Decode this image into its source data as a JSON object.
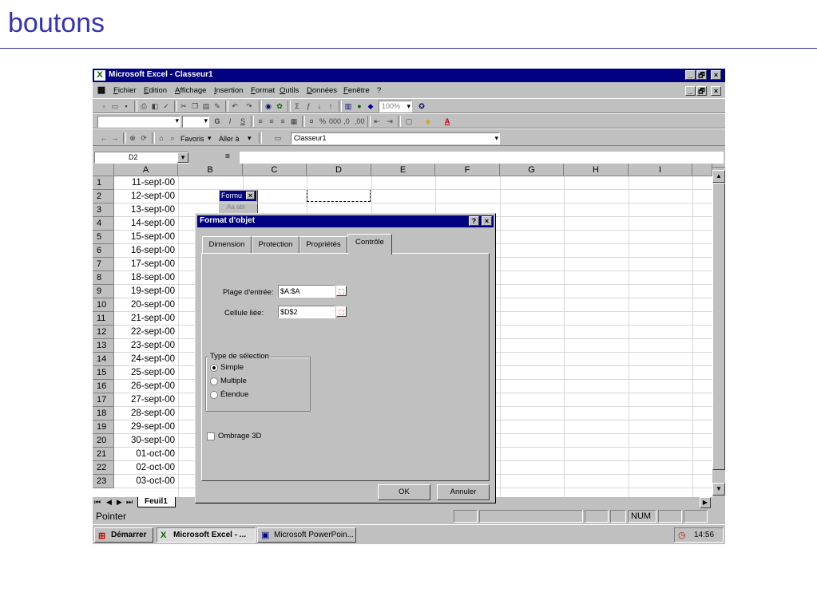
{
  "slide": {
    "title": "boutons"
  },
  "window": {
    "title": "Microsoft Excel - Classeur1",
    "minimize": "_",
    "restore": "🗗",
    "close": "×"
  },
  "menu": [
    "Fichier",
    "Edition",
    "Affichage",
    "Insertion",
    "Format",
    "Outils",
    "Données",
    "Fenêtre",
    "?"
  ],
  "toolbar": {
    "zoom": "100%",
    "favoris": "Favoris",
    "aller": "Aller à",
    "address": "Classeur1"
  },
  "formula_bar": {
    "name_box": "D2",
    "equals": "="
  },
  "columns": [
    "A",
    "B",
    "C",
    "D",
    "E",
    "F",
    "G",
    "H",
    "I"
  ],
  "rows": [
    {
      "n": "1",
      "a": "11-sept-00"
    },
    {
      "n": "2",
      "a": "12-sept-00"
    },
    {
      "n": "3",
      "a": "13-sept-00"
    },
    {
      "n": "4",
      "a": "14-sept-00"
    },
    {
      "n": "5",
      "a": "15-sept-00"
    },
    {
      "n": "6",
      "a": "16-sept-00"
    },
    {
      "n": "7",
      "a": "17-sept-00"
    },
    {
      "n": "8",
      "a": "18-sept-00"
    },
    {
      "n": "9",
      "a": "19-sept-00"
    },
    {
      "n": "10",
      "a": "20-sept-00"
    },
    {
      "n": "11",
      "a": "21-sept-00"
    },
    {
      "n": "12",
      "a": "22-sept-00"
    },
    {
      "n": "13",
      "a": "23-sept-00"
    },
    {
      "n": "14",
      "a": "24-sept-00"
    },
    {
      "n": "15",
      "a": "25-sept-00"
    },
    {
      "n": "16",
      "a": "26-sept-00"
    },
    {
      "n": "17",
      "a": "27-sept-00"
    },
    {
      "n": "18",
      "a": "28-sept-00"
    },
    {
      "n": "19",
      "a": "29-sept-00"
    },
    {
      "n": "20",
      "a": "30-sept-00"
    },
    {
      "n": "21",
      "a": "01-oct-00"
    },
    {
      "n": "22",
      "a": "02-oct-00"
    },
    {
      "n": "23",
      "a": "03-oct-00"
    }
  ],
  "forms_palette": {
    "title": "Formu",
    "close": "×",
    "item": "Aa abl"
  },
  "dialog": {
    "title": "Format d'objet",
    "help": "?",
    "close": "×",
    "tabs": [
      "Dimension",
      "Protection",
      "Propriétés",
      "Contrôle"
    ],
    "input_range_label": "Plage d'entrée:",
    "input_range_value": "$A:$A",
    "linked_cell_label": "Cellule liée:",
    "linked_cell_value": "$D$2",
    "selection_group": "Type de sélection",
    "options": [
      "Simple",
      "Multiple",
      "Étendue"
    ],
    "shading": "Ombrage 3D",
    "ok": "OK",
    "cancel": "Annuler"
  },
  "sheet_tab": "Feuil1",
  "status": {
    "mode": "Pointer",
    "num": "NUM"
  },
  "taskbar": {
    "start": "Démarrer",
    "excel": "Microsoft Excel - ...",
    "ppt": "Microsoft PowerPoin...",
    "clock": "14:56"
  }
}
